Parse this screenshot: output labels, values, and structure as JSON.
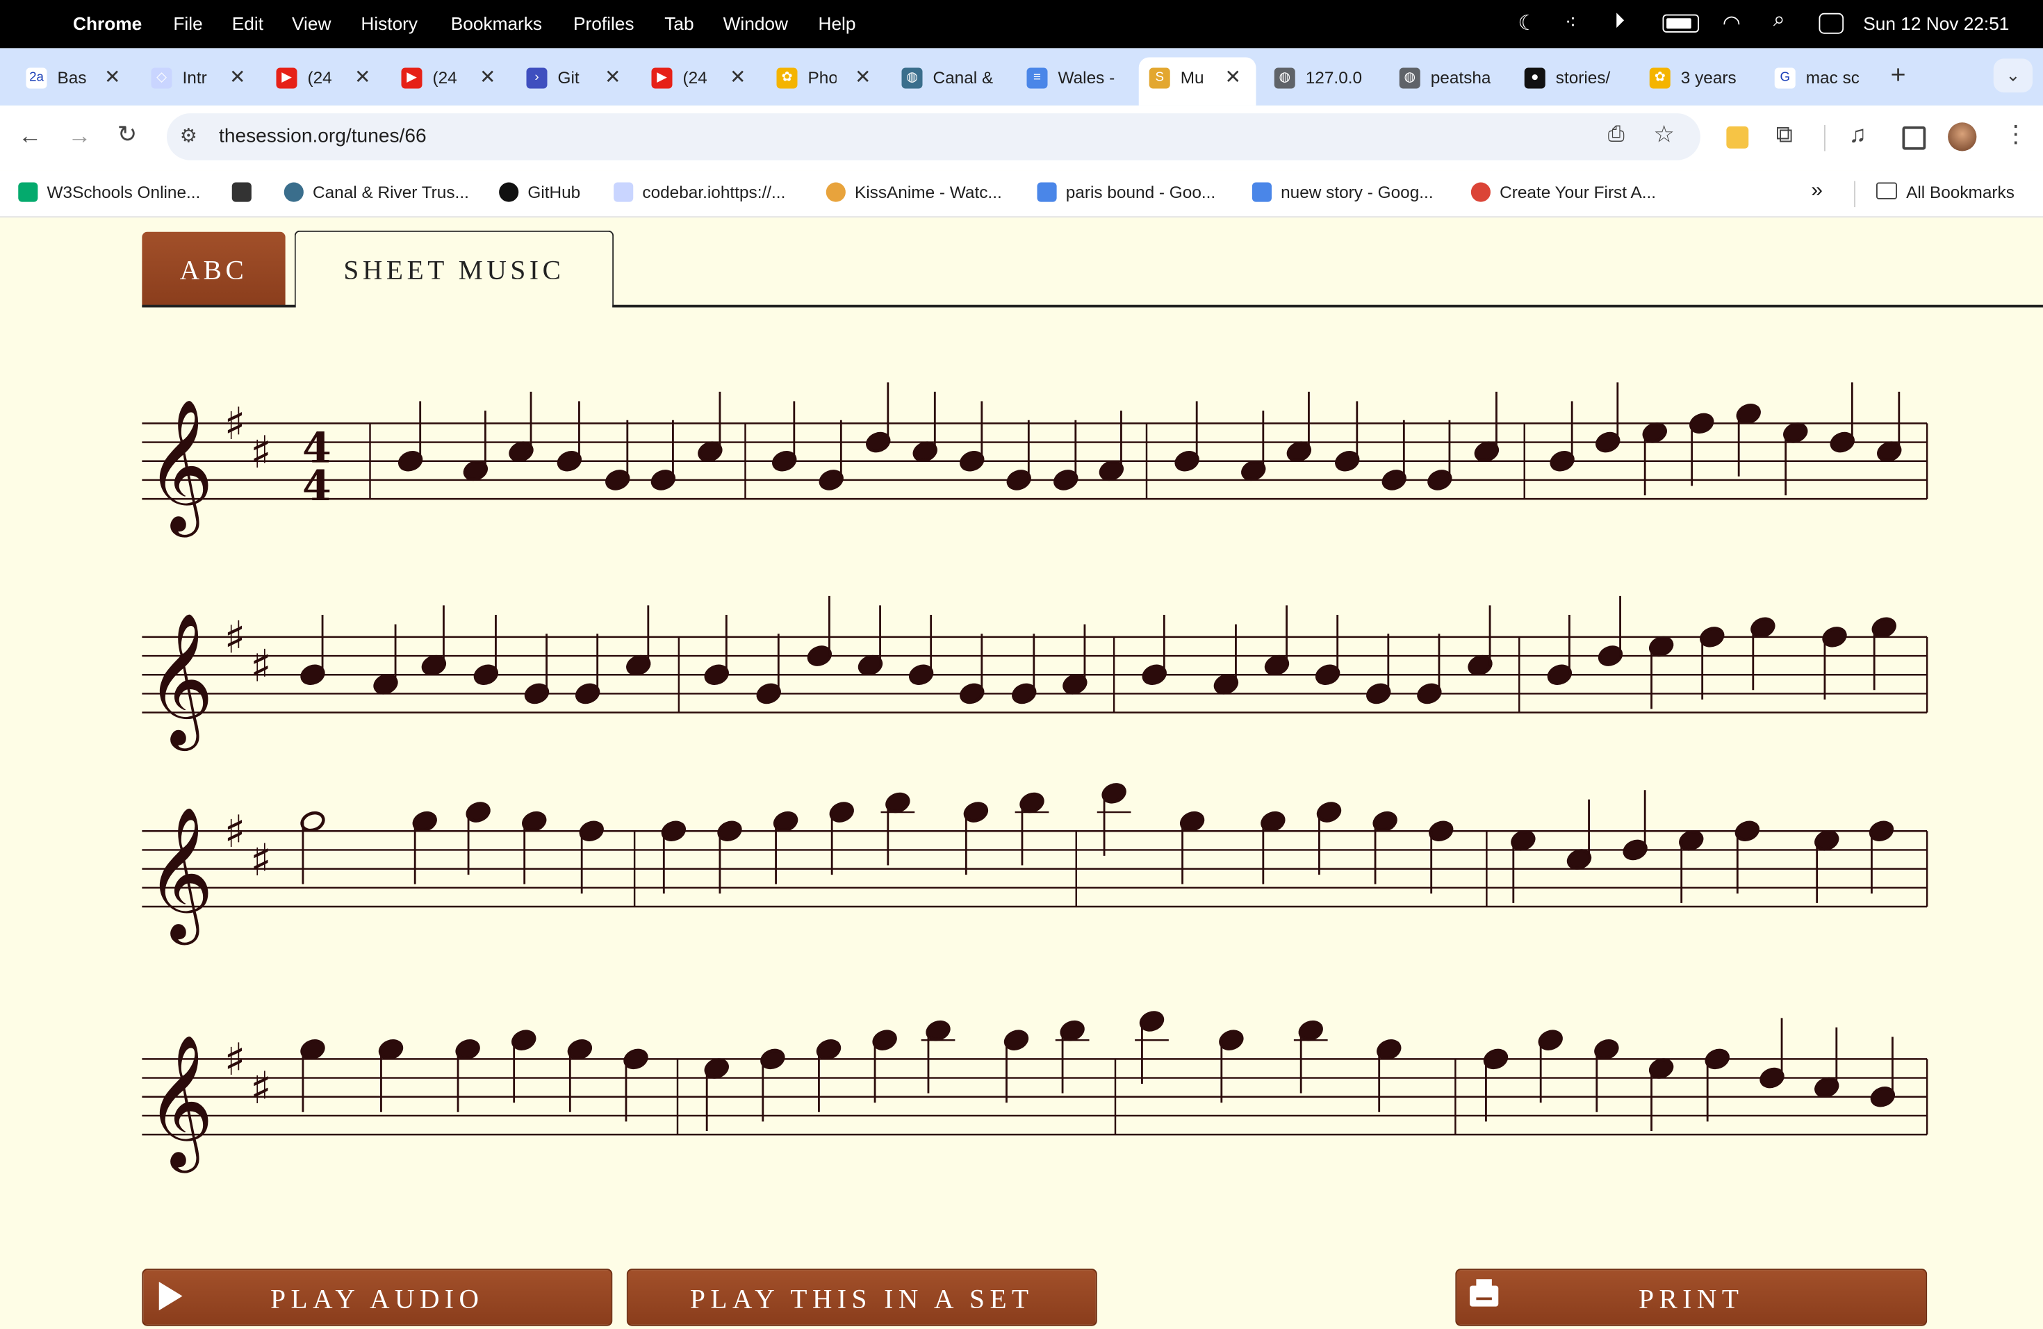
{
  "menubar": {
    "app": "Chrome",
    "items": [
      "File",
      "Edit",
      "View",
      "History",
      "Bookmarks",
      "Profiles",
      "Tab",
      "Window",
      "Help"
    ],
    "datetime": "Sun 12 Nov  22:51"
  },
  "tabs": [
    {
      "label": "Bas",
      "color": "#ffffff",
      "glyph": "2a"
    },
    {
      "label": "Intr",
      "color": "#c9d5ff",
      "glyph": "◇"
    },
    {
      "label": "(24",
      "color": "#e62117",
      "glyph": "▶"
    },
    {
      "label": "(24",
      "color": "#e62117",
      "glyph": "▶"
    },
    {
      "label": "Git",
      "color": "#3f4fbf",
      "glyph": "›"
    },
    {
      "label": "(24",
      "color": "#e62117",
      "glyph": "▶"
    },
    {
      "label": "Pho",
      "color": "#f4b400",
      "glyph": "✿"
    },
    {
      "label": "Canal &",
      "color": "#3a6e8c",
      "glyph": "◍"
    },
    {
      "label": "Wales -",
      "color": "#4a86e8",
      "glyph": "≡"
    },
    {
      "label": "Mu",
      "color": "#e3a72f",
      "glyph": "S"
    },
    {
      "label": "127.0.0",
      "color": "#5f6368",
      "glyph": "◍"
    },
    {
      "label": "peatsha",
      "color": "#5f6368",
      "glyph": "◍"
    },
    {
      "label": "stories/",
      "color": "#111111",
      "glyph": "●"
    },
    {
      "label": "3 years",
      "color": "#f4b400",
      "glyph": "✿"
    },
    {
      "label": "mac sc",
      "color": "#ffffff",
      "glyph": "G"
    }
  ],
  "address": {
    "url": "thesession.org/tunes/66"
  },
  "bookmarks": [
    {
      "label": "W3Schools Online...",
      "color": "#04aa6d"
    },
    {
      "label": "",
      "color": "#333333"
    },
    {
      "label": "Canal & River Trus...",
      "color": "#3a6e8c"
    },
    {
      "label": "GitHub",
      "color": "#111111"
    },
    {
      "label": "codebar.iohttps://...",
      "color": "#c9d5ff"
    },
    {
      "label": "KissAnime - Watc...",
      "color": "#e8a33c"
    },
    {
      "label": "paris bound - Goo...",
      "color": "#4a86e8"
    },
    {
      "label": "nuew story - Goog...",
      "color": "#4a86e8"
    },
    {
      "label": "Create Your First A...",
      "color": "#db4437"
    }
  ],
  "all_bookmarks": "All Bookmarks",
  "view_tabs": {
    "abc": "ABC",
    "sheet": "SHEET MUSIC"
  },
  "buttons": {
    "play_audio": "PLAY AUDIO",
    "play_set": "PLAY THIS IN A SET",
    "print": "PRINT"
  },
  "sheet": {
    "clef": "treble",
    "key": "D major (2 sharps)",
    "time": "4/4",
    "systems": 4
  }
}
